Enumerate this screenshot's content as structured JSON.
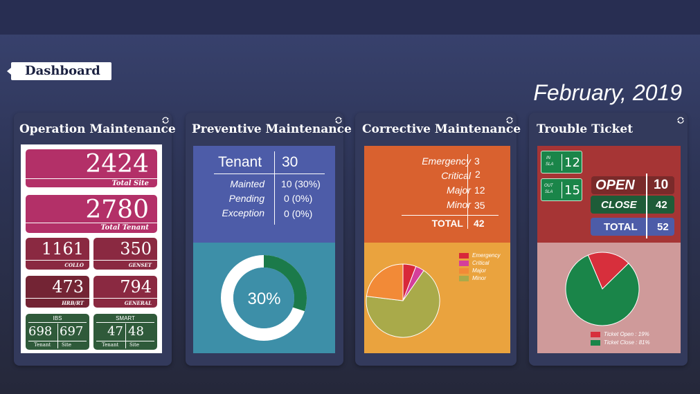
{
  "header": {
    "tab_label": "Dashboard",
    "date": "February, 2019"
  },
  "colors": {
    "magenta": "#b33068",
    "maroon": "#8a2941",
    "dark_red": "#732434",
    "green_dark": "#2f5a3a",
    "blue": "#4d5ca8",
    "teal": "#3d8fa8",
    "orange": "#d9612f",
    "gold": "#eaa33e",
    "tt_red": "#a63535",
    "tt_pink": "#cf9a9a",
    "tt_green": "#1a8549"
  },
  "operation": {
    "title": "Operation Maintenance",
    "total_site": {
      "value": "2424",
      "label": "Total Site"
    },
    "total_tenant": {
      "value": "2780",
      "label": "Total Tenant"
    },
    "collo": {
      "value": "1161",
      "label": "COLLO"
    },
    "genset": {
      "value": "350",
      "label": "GENSET"
    },
    "hrb": {
      "value": "473",
      "label": "HRB/RT"
    },
    "general": {
      "value": "794",
      "label": "GENERAL"
    },
    "ibs": {
      "title": "IBS",
      "tenant": "698",
      "site": "697",
      "tenant_label": "Tenant",
      "site_label": "Site"
    },
    "smart": {
      "title": "SMART",
      "tenant": "47",
      "site": "48",
      "tenant_label": "Tenant",
      "site_label": "Site"
    }
  },
  "preventive": {
    "title": "Preventive Maintenance",
    "tenant_label": "Tenant",
    "tenant_value": "30",
    "rows": [
      {
        "label": "Mainted",
        "value": "10 (30%)"
      },
      {
        "label": "Pending",
        "value": "0 (0%)"
      },
      {
        "label": "Exception",
        "value": "0 (0%)"
      }
    ],
    "donut_label": "30%",
    "donut_fraction": 0.3
  },
  "corrective": {
    "title": "Corrective Maintenance",
    "rows": [
      {
        "label": "Emergency",
        "value": "3"
      },
      {
        "label": "Critical",
        "value": "2"
      },
      {
        "label": "Major",
        "value": "12"
      },
      {
        "label": "Minor",
        "value": "35"
      }
    ],
    "total_label": "TOTAL",
    "total_value": "42"
  },
  "trouble": {
    "title": "Trouble Ticket",
    "in_sla": {
      "label_top": "IN",
      "label_bottom": "SLA",
      "value": "12"
    },
    "out_sla": {
      "label_top": "OUT",
      "label_bottom": "SLA",
      "value": "15"
    },
    "open": {
      "label": "OPEN",
      "value": "10"
    },
    "close": {
      "label": "CLOSE",
      "value": "42"
    },
    "total": {
      "label": "TOTAL",
      "value": "52"
    }
  },
  "chart_data": [
    {
      "type": "pie",
      "title": "",
      "categories": [
        "Emergency",
        "Critical",
        "Major",
        "Minor"
      ],
      "values": [
        3,
        2,
        12,
        35
      ],
      "colors": [
        "#d8283a",
        "#d43f9b",
        "#f28a37",
        "#a9aa4a"
      ]
    },
    {
      "type": "pie",
      "title": "",
      "categories": [
        "Ticket Open : 19%",
        "Ticket Close : 81%"
      ],
      "values": [
        19,
        81
      ],
      "colors": [
        "#d72f3c",
        "#1a8549"
      ]
    }
  ]
}
